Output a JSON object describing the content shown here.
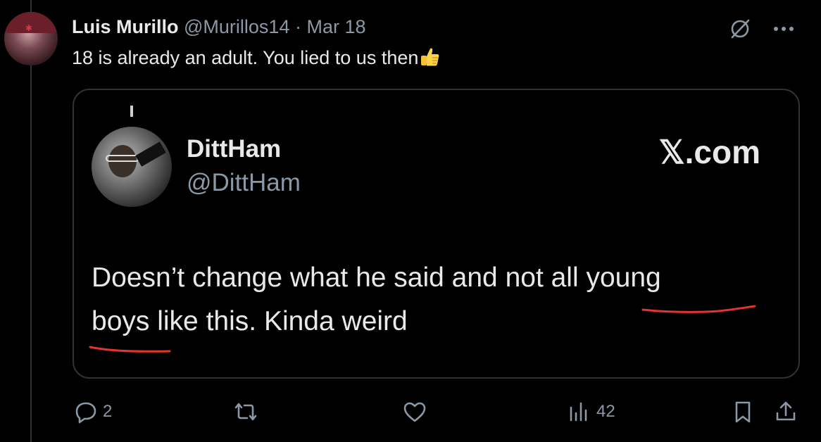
{
  "author": {
    "name": "Luis Murillo",
    "handle": "@Murillos14",
    "separator": "·",
    "date": "Mar 18"
  },
  "tweet": {
    "text": "18 is already an adult. You lied to us then",
    "emoji_icon": "thumbs-up-icon"
  },
  "quote": {
    "name": "DittHam",
    "handle": "@DittHam",
    "source": "𝕏.com",
    "line1_a": "Doesn’t change what he said and not all ",
    "line1_b": "young",
    "line2_a": "boys",
    "line2_b": " like this. Kinda weird",
    "underline_color": "#e3342f"
  },
  "actions": {
    "reply_count": "2",
    "views_count": "42"
  },
  "colors": {
    "background": "#000000",
    "text": "#e7e9ea",
    "muted": "#8b98a5",
    "border": "#2f3336"
  }
}
